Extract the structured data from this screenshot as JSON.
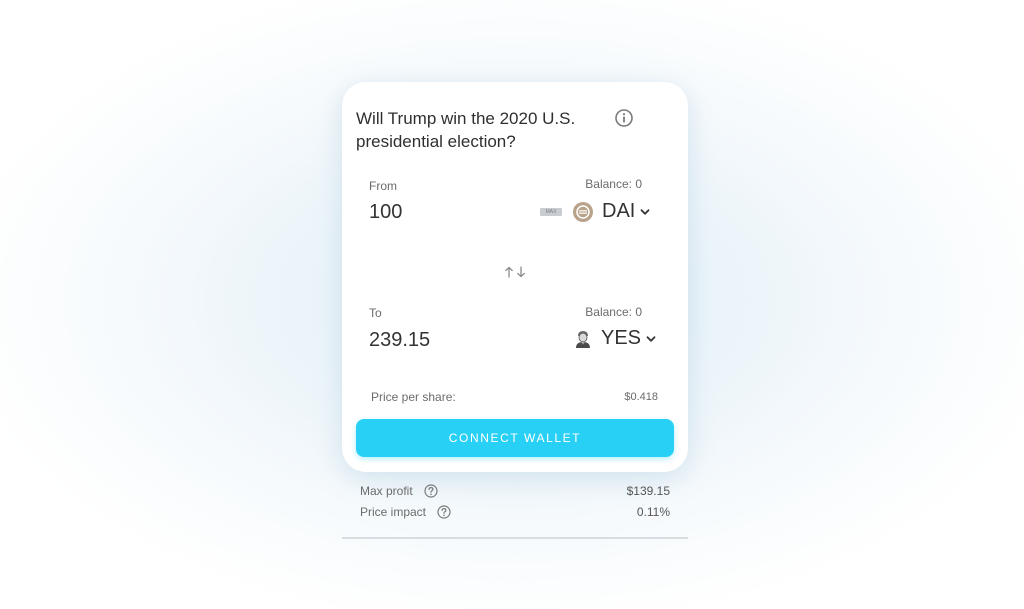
{
  "market": {
    "question": "Will Trump win the 2020 U.S. presidential election?"
  },
  "from": {
    "label": "From",
    "balance": "Balance: 0",
    "amount": "100",
    "max_label": "MAX",
    "token": "DAI",
    "token_icon": "dai-coin-icon"
  },
  "to": {
    "label": "To",
    "balance": "Balance: 0",
    "amount": "239.15",
    "token": "YES",
    "token_icon": "trump-portrait-icon"
  },
  "price_per_share": {
    "label": "Price per share:",
    "value": "$0.418"
  },
  "connect_button": {
    "label": "CONNECT WALLET"
  },
  "summary": {
    "max_profit": {
      "label": "Max profit",
      "value": "$139.15"
    },
    "price_impact": {
      "label": "Price impact",
      "value": "0.11%"
    }
  },
  "colors": {
    "accent": "#29d0f5",
    "text": "#333333",
    "muted": "#6b6b6b"
  }
}
